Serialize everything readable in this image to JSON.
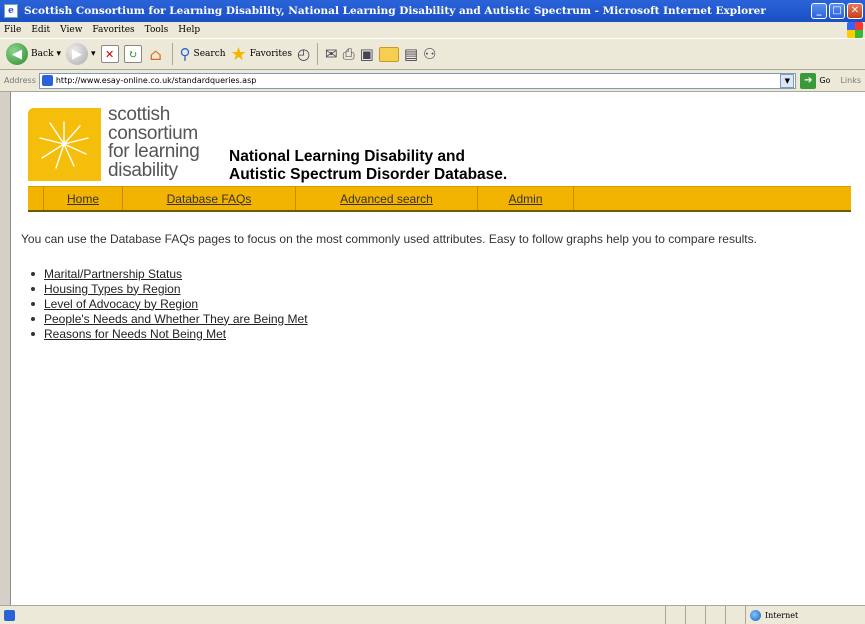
{
  "window": {
    "title": "Scottish Consortium for Learning Disability, National Learning Disability and Autistic Spectrum - Microsoft Internet Explorer",
    "minimize": "_",
    "maximize": "□",
    "close": "✕"
  },
  "menu": [
    "File",
    "Edit",
    "View",
    "Favorites",
    "Tools",
    "Help"
  ],
  "toolbar": {
    "back_label": "Back",
    "search_label": "Search",
    "favorites_label": "Favorites"
  },
  "address": {
    "label": "Address",
    "url": "http://www.esay-online.co.uk/standardqueries.asp",
    "go_label": "Go",
    "links_label": "Links"
  },
  "site": {
    "logo_lines": [
      "scottish",
      "consortium",
      "for learning",
      "disability"
    ],
    "title_line1": "National Learning Disability and",
    "title_line2": "Autistic Spectrum Disorder Database."
  },
  "nav": [
    {
      "label": "Home"
    },
    {
      "label": "Database FAQs"
    },
    {
      "label": "Advanced search"
    },
    {
      "label": "Admin"
    }
  ],
  "intro_text": "You can use the Database FAQs pages to focus on the most commonly used attributes. Easy to follow graphs help you to compare results.",
  "faq_links": [
    "Marital/Partnership Status",
    "Housing Types by Region",
    "Level of Advocacy by Region",
    "People's Needs and Whether They are Being Met",
    "Reasons for Needs Not Being Met"
  ],
  "status": {
    "zone": "Internet"
  },
  "colors": {
    "nav_bg": "#f2b400",
    "titlebar": "#2a63d8"
  }
}
